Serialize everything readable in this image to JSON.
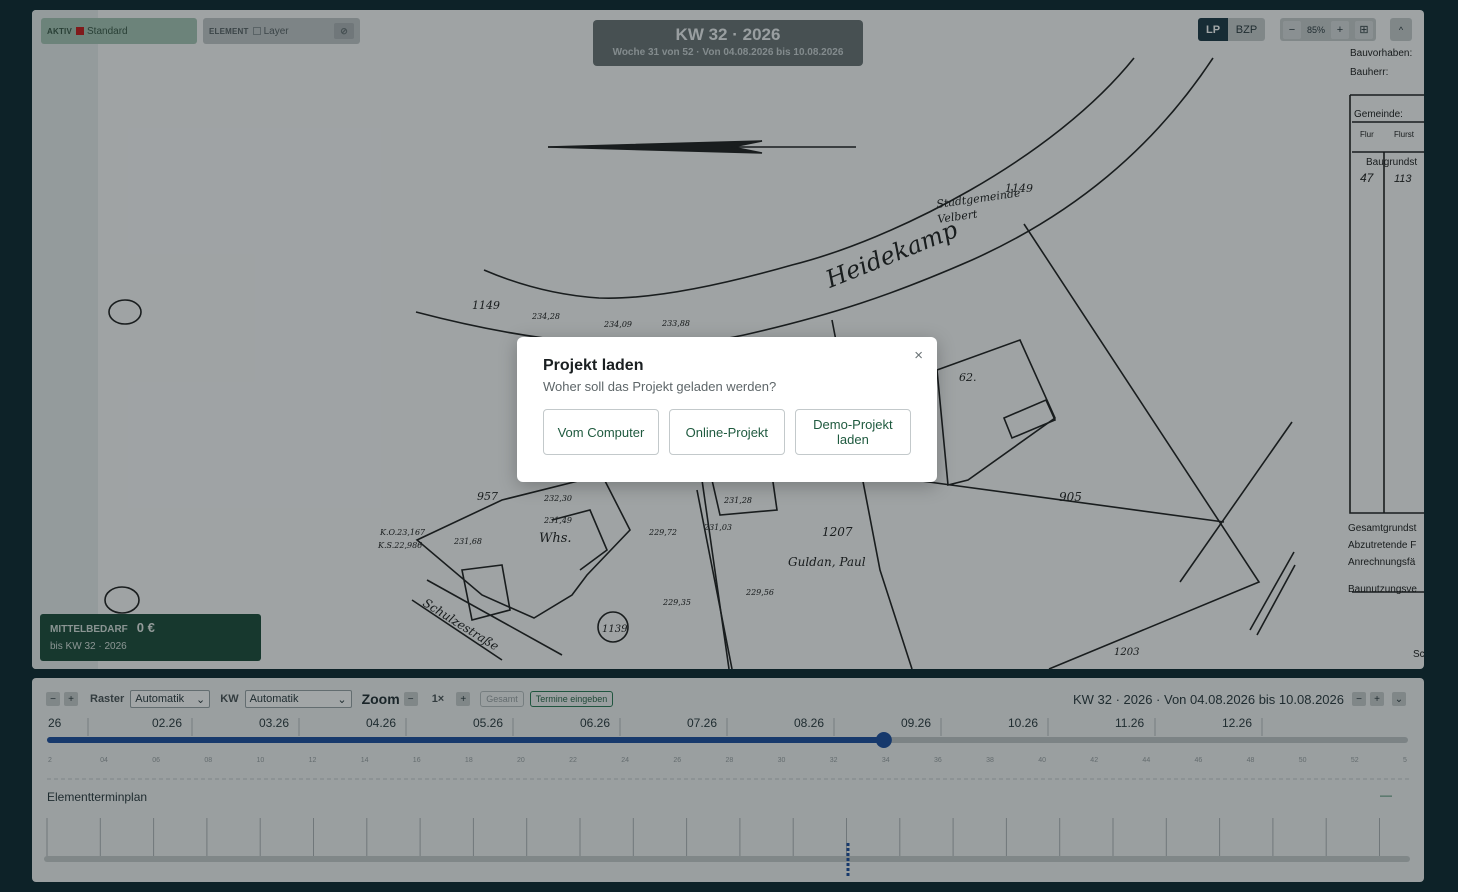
{
  "map": {
    "chips": {
      "aktiv_label": "AKTIV",
      "aktiv_value": "Standard",
      "element_label": "ELEMENT",
      "element_value": "Layer"
    },
    "banner": {
      "title": "KW 32 · 2026",
      "subtitle": "Woche 31 von 52 · Von 04.08.2026 bis 10.08.2026"
    },
    "view_toggle": {
      "lp": "LP",
      "bzp": "BZP"
    },
    "zoom": {
      "minus": "−",
      "value": "85%",
      "plus": "+",
      "fit_icon": "grid-icon"
    },
    "collapse": "^",
    "mittelbedarf": {
      "label": "MITTELBEDARF",
      "value": "0 €",
      "sub": "bis KW 32 · 2026"
    },
    "drawing_texts": {
      "street": "Heidekamp",
      "owner1": "Stadtgemeinde",
      "owner2": "Velbert",
      "parcel_1149a": "1149",
      "parcel_1149b": "1149",
      "n62": "62.",
      "n905": "905",
      "n1207": "1207",
      "owner3": "Guldan, Paul",
      "n1203": "1203",
      "n957": "957",
      "whs": "Whs.",
      "n1139": "1139",
      "street2": "Schulzestraße",
      "h1": "234,28",
      "h2": "234,09",
      "h3": "233,88",
      "h4": "231,28",
      "h5": "231,03",
      "h6": "229,56",
      "h7": "229,35",
      "h8": "229,72",
      "h9": "231,68",
      "h10": "232,30",
      "h11": "231,49",
      "ko1": "K.O.23,167",
      "ko2": "K.S.22,986",
      "side1": "Bauvorhaben:",
      "side2": "Bauherr:",
      "side3": "Gemeinde:",
      "side4": "Flur",
      "side5": "Flurst",
      "side6": "Baugrundst",
      "side7": "47",
      "side8": "113",
      "side9": "Gesamtgrundst",
      "side10": "Abzutretende F",
      "side11": "Anrechnungsfä",
      "side12": "Baunutzungsve",
      "side13": "Sc"
    }
  },
  "timeline": {
    "toolbar": {
      "raster_label": "Raster",
      "raster_value": "Automatik",
      "kw_label": "KW",
      "kw_value": "Automatik",
      "zoom_label": "Zoom",
      "zoom_factor": "1×",
      "gesamt": "Gesamt",
      "termine": "Termine eingeben",
      "info": "KW 32 · 2026 · Von 04.08.2026 bis 10.08.2026"
    },
    "months": [
      "26",
      "02.26",
      "03.26",
      "04.26",
      "05.26",
      "06.26",
      "07.26",
      "08.26",
      "09.26",
      "10.26",
      "11.26",
      "12.26"
    ],
    "weeks": [
      "2",
      "04",
      "06",
      "08",
      "10",
      "12",
      "14",
      "16",
      "18",
      "20",
      "22",
      "24",
      "26",
      "28",
      "30",
      "32",
      "34",
      "36",
      "38",
      "40",
      "42",
      "44",
      "46",
      "48",
      "50",
      "52",
      "5"
    ],
    "current_week": 32,
    "total_weeks": 52,
    "section_title": "Elementterminplan",
    "section_toggle": "—"
  },
  "modal": {
    "title": "Projekt laden",
    "subtitle": "Woher soll das Projekt geladen werden?",
    "close": "×",
    "buttons": {
      "computer": "Vom Computer",
      "online": "Online-Projekt",
      "demo": "Demo-Projekt laden"
    }
  },
  "colors": {
    "background": "#0f2a33",
    "accent_green": "#1f5a3f",
    "timeline_blue": "#1f4fa0",
    "mittel_bg": "#1f4e3d"
  }
}
